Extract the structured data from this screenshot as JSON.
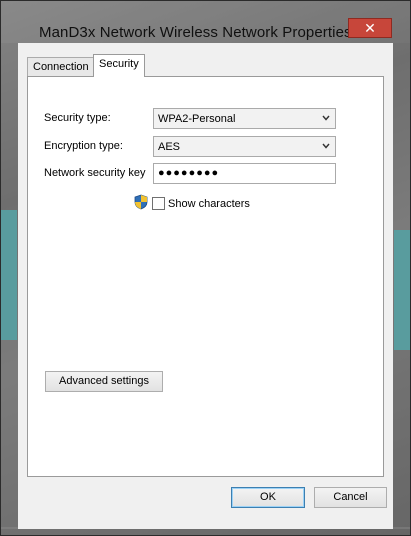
{
  "window": {
    "title": "ManD3x Network Wireless Network Properties",
    "close_glyph": "✕"
  },
  "tabs": [
    {
      "label": "Connection",
      "active": false
    },
    {
      "label": "Security",
      "active": true
    }
  ],
  "security": {
    "security_type_label": "Security type:",
    "security_type_value": "WPA2-Personal",
    "encryption_type_label": "Encryption type:",
    "encryption_type_value": "AES",
    "network_key_label": "Network security key",
    "network_key_value": "●●●●●●●●",
    "show_characters_label": "Show characters",
    "show_characters_checked": false
  },
  "buttons": {
    "advanced_label": "Advanced settings",
    "ok_label": "OK",
    "cancel_label": "Cancel"
  },
  "colors": {
    "close_button": "#c7463a",
    "wallpaper_accent": "#3aa0a3",
    "default_button_border": "#3c7fb1"
  },
  "icons": {
    "shield": "uac-shield-icon",
    "dropdown": "chevron-down-icon",
    "close": "close-icon"
  }
}
